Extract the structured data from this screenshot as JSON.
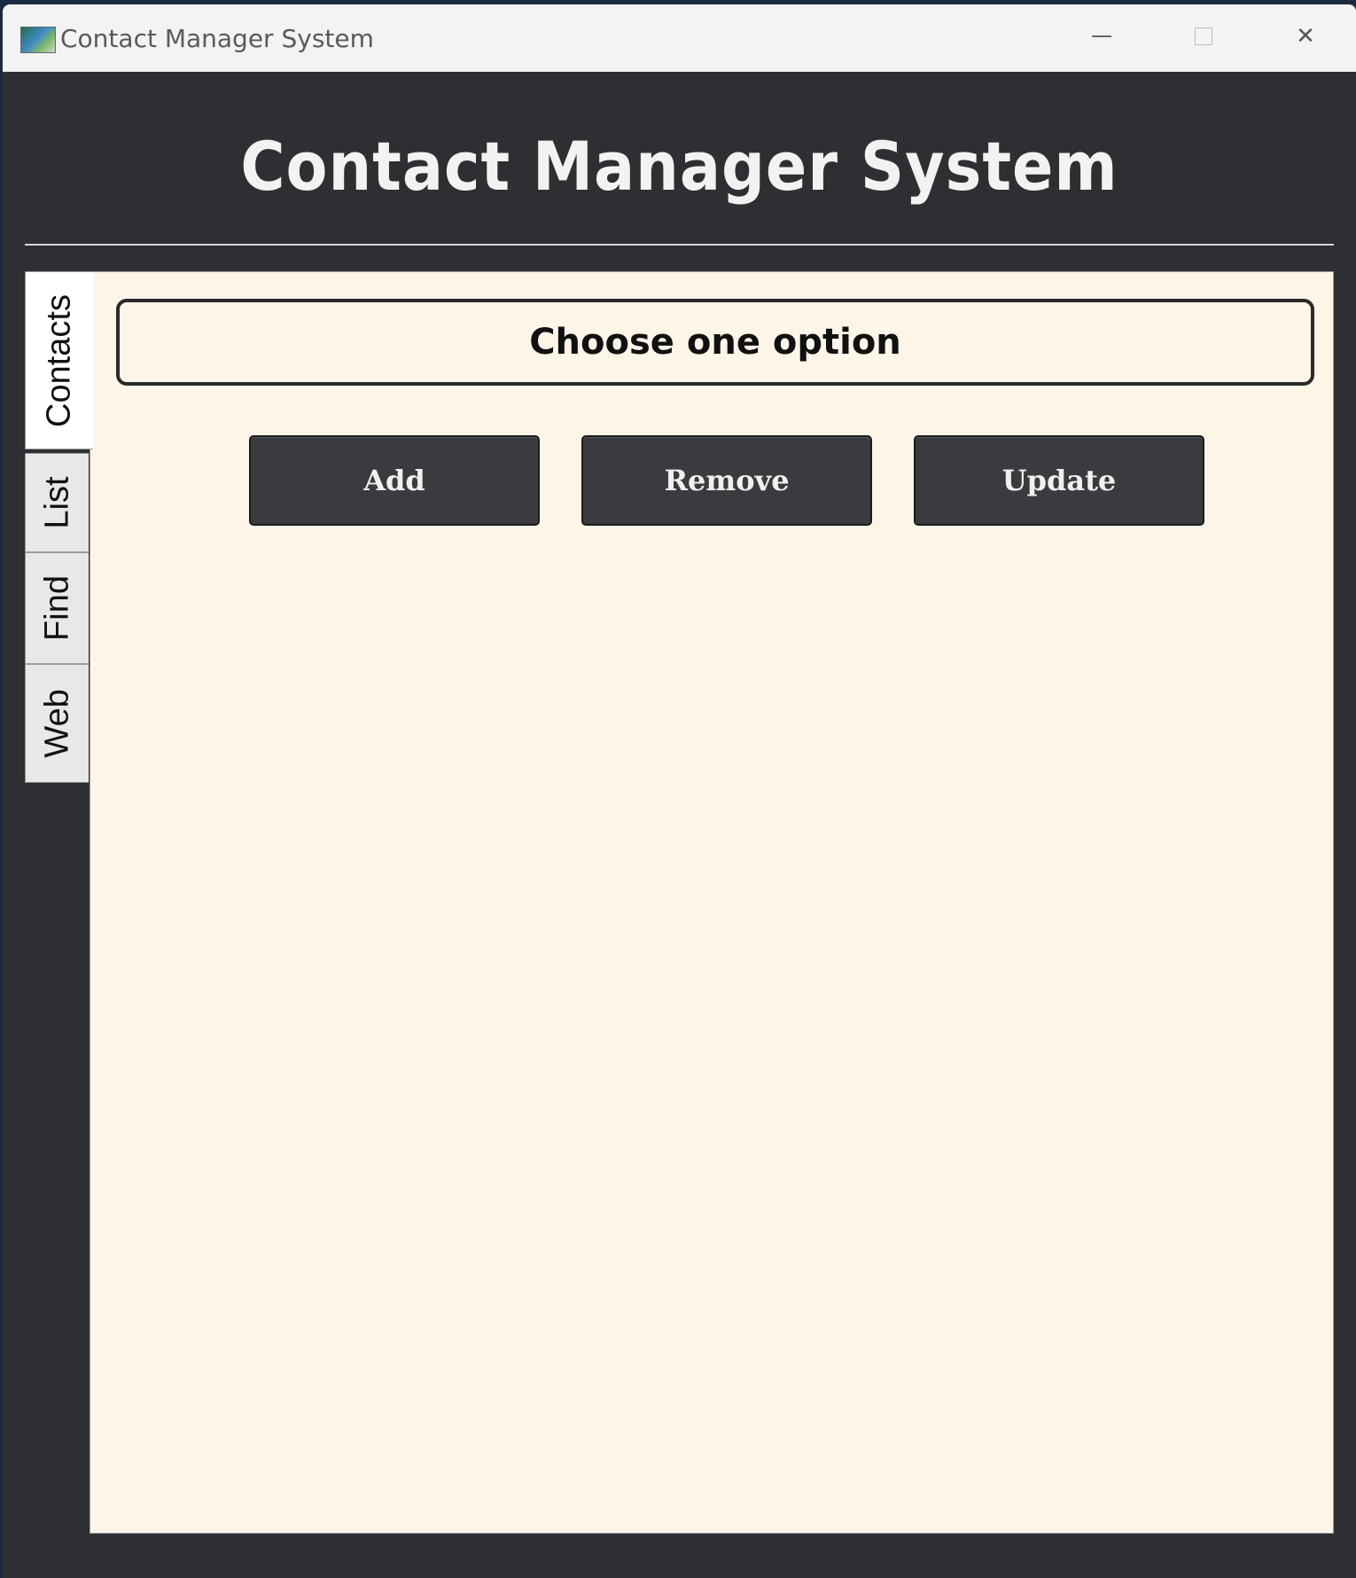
{
  "window": {
    "title": "Contact Manager System",
    "controls": {
      "minimize_icon": "minimize-icon",
      "maximize_icon": "maximize-icon",
      "close_icon": "close-icon",
      "close_glyph": "✕"
    }
  },
  "header": {
    "heading": "Contact Manager System"
  },
  "tabs": [
    {
      "label": "Contacts",
      "active": true
    },
    {
      "label": "List",
      "active": false
    },
    {
      "label": "Find",
      "active": false
    },
    {
      "label": "Web",
      "active": false
    }
  ],
  "contacts_panel": {
    "prompt": "Choose one option",
    "buttons": {
      "add": "Add",
      "remove": "Remove",
      "update": "Update"
    }
  },
  "colors": {
    "window_bg": "#2e2f32",
    "panel_bg": "#fdf5e8",
    "button_bg": "#3a3b3e"
  }
}
